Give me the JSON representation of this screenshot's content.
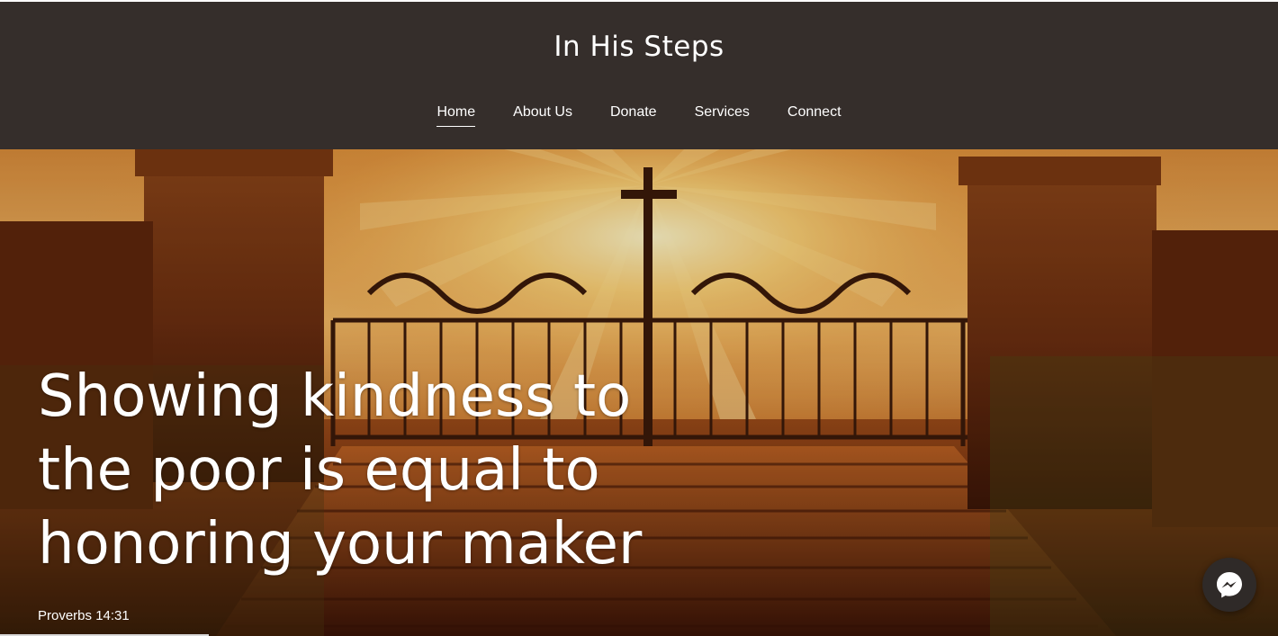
{
  "header": {
    "title": "In His Steps",
    "nav": [
      {
        "label": "Home",
        "active": true
      },
      {
        "label": "About Us",
        "active": false
      },
      {
        "label": "Donate",
        "active": false
      },
      {
        "label": "Services",
        "active": false
      },
      {
        "label": "Connect",
        "active": false
      }
    ]
  },
  "hero": {
    "heading": "Showing kindness to the poor is equal to honoring your maker",
    "caption": "Proverbs 14:31",
    "image_subject": "golden gate with cross and sun rays between stone pillars"
  },
  "chat_widget": {
    "icon": "messenger-icon"
  },
  "colors": {
    "header_bg": "#352e2b",
    "text": "#ffffff",
    "accent_gold": "#f2b13a"
  }
}
